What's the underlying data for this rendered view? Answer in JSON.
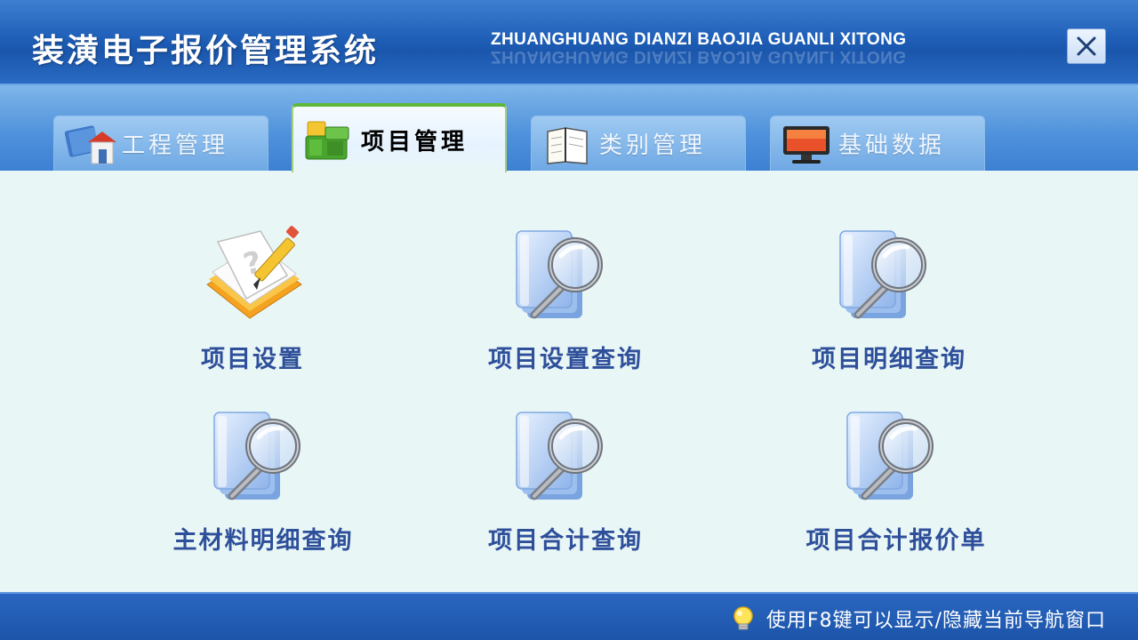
{
  "window": {
    "title_cn": "装潢电子报价管理系统",
    "title_en": "ZHUANGHUANG DIANZI BAOJIA GUANLI XITONG",
    "close_icon": "close-icon"
  },
  "tabs": [
    {
      "label": "工程管理",
      "icon": "house-book-icon",
      "active": false
    },
    {
      "label": "项目管理",
      "icon": "green-blocks-icon",
      "active": true
    },
    {
      "label": "类别管理",
      "icon": "notebook-icon",
      "active": false
    },
    {
      "label": "基础数据",
      "icon": "monitor-icon",
      "active": false
    }
  ],
  "functions": [
    {
      "label": "项目设置",
      "icon": "notepad-pencil-icon"
    },
    {
      "label": "项目设置查询",
      "icon": "document-search-icon"
    },
    {
      "label": "项目明细查询",
      "icon": "document-search-icon"
    },
    {
      "label": "主材料明细查询",
      "icon": "document-search-icon"
    },
    {
      "label": "项目合计查询",
      "icon": "document-search-icon"
    },
    {
      "label": "项目合计报价单",
      "icon": "document-search-icon"
    }
  ],
  "status": {
    "hint": "使用F8键可以显示/隐藏当前导航窗口",
    "icon": "lightbulb-icon"
  },
  "colors": {
    "title_bg": "#1f5fb8",
    "tab_active_border": "#5fb83a",
    "content_bg": "#e9f6f6",
    "function_label": "#2e4f9a"
  }
}
